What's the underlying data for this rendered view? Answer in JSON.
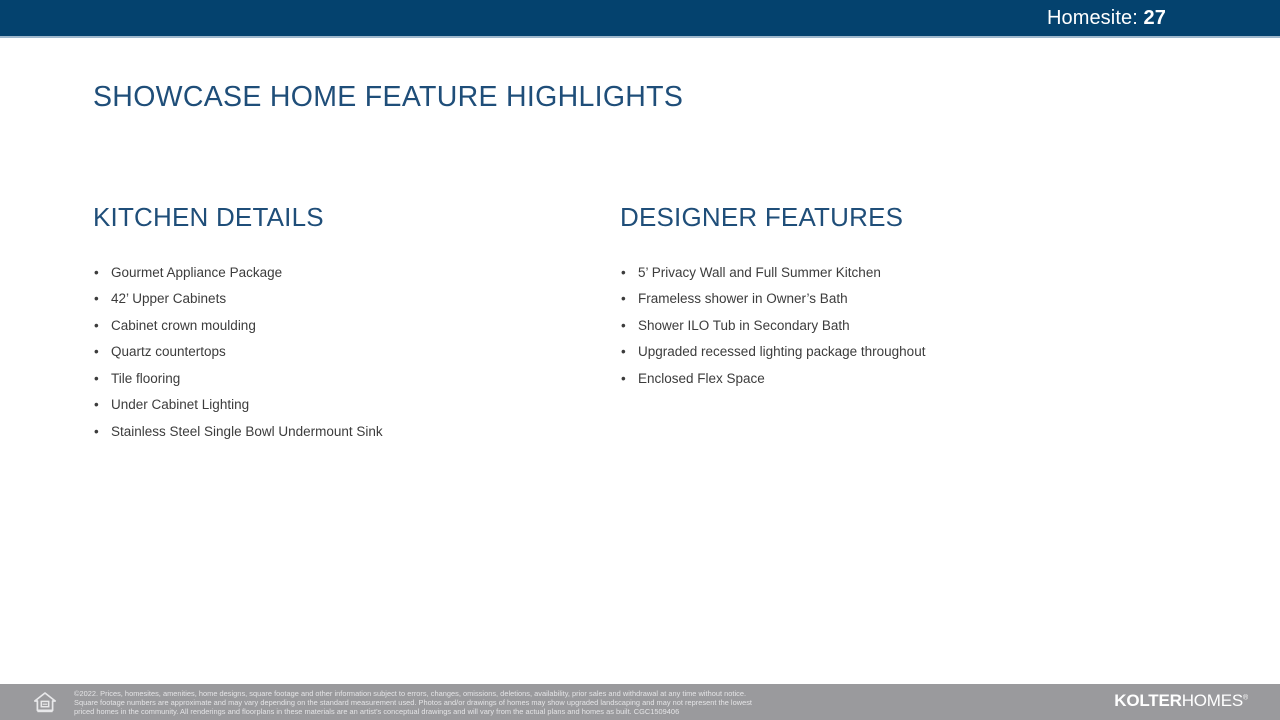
{
  "header": {
    "homesite_label": "Homesite:",
    "homesite_number": "27",
    "background_color": "#04426E"
  },
  "slide": {
    "title": "SHOWCASE HOME FEATURE HIGHLIGHTS",
    "title_color": "#1F4E79"
  },
  "columns": [
    {
      "heading": "KITCHEN DETAILS",
      "items": [
        "Gourmet Appliance Package",
        "42’ Upper Cabinets",
        "Cabinet crown moulding",
        "Quartz countertops",
        "Tile flooring",
        "Under Cabinet Lighting",
        "Stainless Steel Single Bowl Undermount Sink"
      ]
    },
    {
      "heading": "DESIGNER FEATURES",
      "items": [
        "5’ Privacy Wall and Full Summer Kitchen",
        "Frameless shower in Owner’s Bath",
        "Shower ILO Tub in Secondary Bath",
        "Upgraded recessed lighting package throughout",
        "Enclosed Flex Space"
      ]
    }
  ],
  "bullet_glyph": "•",
  "footer": {
    "background_color": "#9A9A9D",
    "disclaimer_lines": [
      "©2022. Prices, homesites, amenities, home designs, square footage and other information subject to errors, changes, omissions, deletions, availability, prior sales and withdrawal at any time without notice.",
      "Square footage numbers are approximate and may vary depending on the standard measurement used. Photos and/or drawings of homes may show upgraded landscaping and may not represent the lowest",
      "priced homes in the community. All renderings and floorplans in these materials are an artist’s conceptual drawings and will vary from the actual plans and homes as built. CGC1509406"
    ],
    "logo": {
      "bold_part": "KOLTER",
      "light_part": "HOMES",
      "trademark": "®"
    }
  }
}
